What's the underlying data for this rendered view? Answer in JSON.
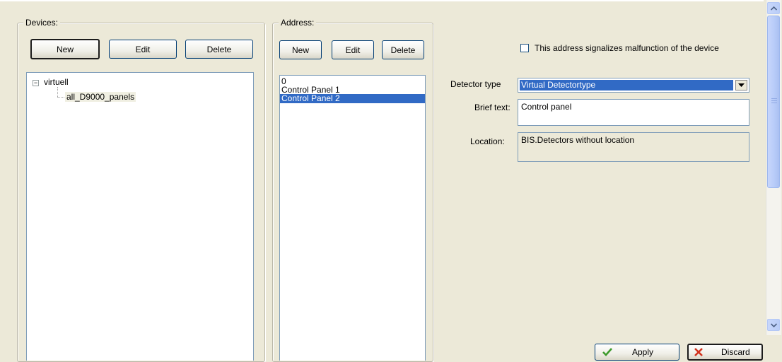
{
  "devices": {
    "legend": "Devices:",
    "buttons": {
      "new": "New",
      "edit": "Edit",
      "delete": "Delete"
    },
    "tree": {
      "root": "virtuell",
      "child": "all_D9000_panels"
    }
  },
  "address": {
    "legend": "Address:",
    "buttons": {
      "new": "New",
      "edit": "Edit",
      "delete": "Delete"
    },
    "items": [
      "0",
      "Control Panel 1",
      "Control Panel 2"
    ],
    "selected_index": 2
  },
  "details": {
    "malfunction_label": "This address signalizes malfunction of the device",
    "malfunction_checked": false,
    "detector_type_label": "Detector type",
    "detector_type_value": "Virtual Detectortype",
    "brief_text_label": "Brief text:",
    "brief_text_value": "Control panel",
    "location_label": "Location:",
    "location_value": "BIS.Detectors without location"
  },
  "footer": {
    "apply": "Apply",
    "discard": "Discard"
  },
  "colors": {
    "selection": "#316ac5",
    "window_bg": "#ece9d8",
    "apply_check": "#3c9a2b",
    "discard_x": "#d2321e"
  },
  "icons": [
    "tree-collapse-icon",
    "dropdown-arrow-icon",
    "scroll-up-icon",
    "scroll-down-icon",
    "check-icon",
    "x-icon"
  ]
}
